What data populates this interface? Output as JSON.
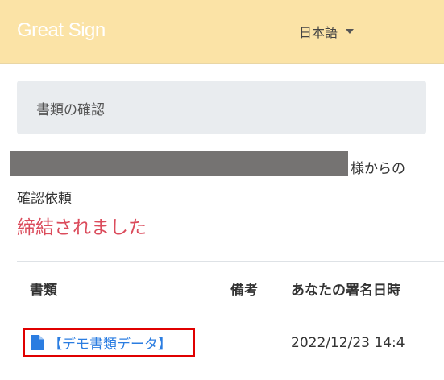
{
  "header": {
    "logo": "Great Sign",
    "language": "日本語"
  },
  "panel": {
    "title": "書類の確認"
  },
  "request": {
    "from_suffix": "様からの",
    "label": "確認依頼",
    "status": "締結されました"
  },
  "table": {
    "headers": [
      "書類",
      "備考",
      "あなたの署名日時"
    ],
    "rows": [
      {
        "document": "【デモ書類データ】",
        "note": "",
        "signed_at": "2022/12/23 14:4"
      }
    ]
  },
  "colors": {
    "header_bg": "#fbe3a6",
    "status": "#db4c5c",
    "link": "#2b7de1",
    "highlight": "#e00000"
  },
  "icons": {
    "document": "file-icon",
    "language": "chevron-down-icon"
  }
}
